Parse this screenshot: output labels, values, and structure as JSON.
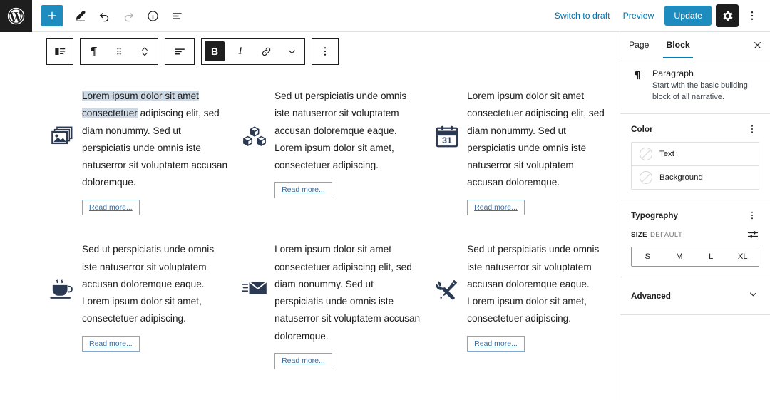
{
  "app": {
    "logo_icon": "wordpress-logo-icon"
  },
  "topbar": {
    "left_tools": [
      {
        "name": "add-block-button",
        "icon": "plus-icon",
        "label": "Add block"
      },
      {
        "name": "edit-tool-button",
        "icon": "pencil-icon",
        "label": "Tools"
      },
      {
        "name": "undo-button",
        "icon": "undo-arrow-icon",
        "label": "Undo"
      },
      {
        "name": "redo-button",
        "icon": "redo-arrow-icon",
        "label": "Redo"
      },
      {
        "name": "details-button",
        "icon": "info-circle-icon",
        "label": "Details"
      },
      {
        "name": "list-view-button",
        "icon": "list-view-icon",
        "label": "List view"
      }
    ],
    "switch_to_draft": "Switch to draft",
    "preview": "Preview",
    "update": "Update",
    "settings_icon": "gear-icon",
    "more_icon": "kebab-vertical-icon",
    "accent_color": "#1e8cbe",
    "link_color": "#0073aa"
  },
  "block_toolbar": {
    "groups": [
      {
        "items": [
          {
            "name": "block-type-icon",
            "icon": "media-text-icon"
          }
        ]
      },
      {
        "items": [
          {
            "name": "paragraph-block-icon",
            "icon": "pilcrow-icon"
          },
          {
            "name": "drag-handle-icon",
            "icon": "drag-dots-icon"
          },
          {
            "name": "move-updown-icon",
            "icon": "chevron-updown-icon"
          }
        ]
      },
      {
        "items": [
          {
            "name": "align-text-button",
            "icon": "align-left-icon"
          }
        ]
      },
      {
        "items": [
          {
            "name": "bold-button",
            "icon": "bold-icon",
            "label": "B",
            "active": true
          },
          {
            "name": "italic-button",
            "icon": "italic-icon",
            "label": "I"
          },
          {
            "name": "link-button",
            "icon": "link-icon"
          },
          {
            "name": "more-rich-text-icon",
            "icon": "chevron-down-icon"
          }
        ]
      },
      {
        "items": [
          {
            "name": "block-options-button",
            "icon": "kebab-vertical-icon"
          }
        ]
      }
    ]
  },
  "content": {
    "rows": [
      {
        "cells": [
          {
            "icon": "gallery-images-icon",
            "text_selected": "Lorem ipsum dolor sit amet consectetuer",
            "text_before_caret": "Lore",
            "text_after_caret": "m ipsum dolor sit amet consectetuer",
            "text_rest": " adipiscing elit, sed diam nonummy. Sed ut perspiciatis unde omnis iste natuserror sit voluptatem accusan doloremque.",
            "read_more": "Read more..."
          },
          {
            "icon": "boxes-cubes-icon",
            "text": "Sed ut perspiciatis unde omnis iste natuserror sit voluptatem accusan doloremque eaque. Lorem ipsum dolor sit amet, consectetuer adipiscing.",
            "read_more": "Read more..."
          },
          {
            "icon": "calendar-31-icon",
            "text": "Lorem ipsum dolor sit amet consectetuer adipiscing elit, sed diam nonummy. Sed ut perspiciatis unde omnis iste natuserror sit voluptatem accusan doloremque.",
            "read_more": "Read more..."
          }
        ]
      },
      {
        "cells": [
          {
            "icon": "coffee-cup-icon",
            "text": "Sed ut perspiciatis unde omnis iste natuserror sit voluptatem accusan doloremque eaque. Lorem ipsum dolor sit amet, consectetuer adipiscing.",
            "read_more": "Read more..."
          },
          {
            "icon": "envelope-mail-icon",
            "text": "Lorem ipsum dolor sit amet consectetuer adipiscing elit, sed diam nonummy. Sed ut perspiciatis unde omnis iste natuserror sit voluptatem accusan doloremque.",
            "read_more": "Read more..."
          },
          {
            "icon": "wrench-screwdriver-icon",
            "text": "Sed ut perspiciatis unde omnis iste natuserror sit voluptatem accusan doloremque eaque. Lorem ipsum dolor sit amet, consectetuer adipiscing.",
            "read_more": "Read more..."
          }
        ]
      }
    ]
  },
  "sidebar": {
    "tabs": [
      {
        "label": "Page",
        "active": false
      },
      {
        "label": "Block",
        "active": true
      }
    ],
    "close_icon": "close-x-icon",
    "block_card": {
      "icon": "pilcrow-icon",
      "title": "Paragraph",
      "description": "Start with the basic building block of all narrative."
    },
    "color": {
      "title": "Color",
      "options_icon": "kebab-vertical-icon",
      "rows": [
        {
          "label": "Text",
          "swatch": "none"
        },
        {
          "label": "Background",
          "swatch": "none"
        }
      ]
    },
    "typography": {
      "title": "Typography",
      "options_icon": "kebab-vertical-icon",
      "size_label": "SIZE",
      "size_value": "DEFAULT",
      "size_settings_icon": "sliders-icon",
      "sizes": [
        "S",
        "M",
        "L",
        "XL"
      ]
    },
    "advanced": {
      "title": "Advanced",
      "chevron_icon": "chevron-down-icon"
    },
    "active_tab_color": "#007cba"
  }
}
